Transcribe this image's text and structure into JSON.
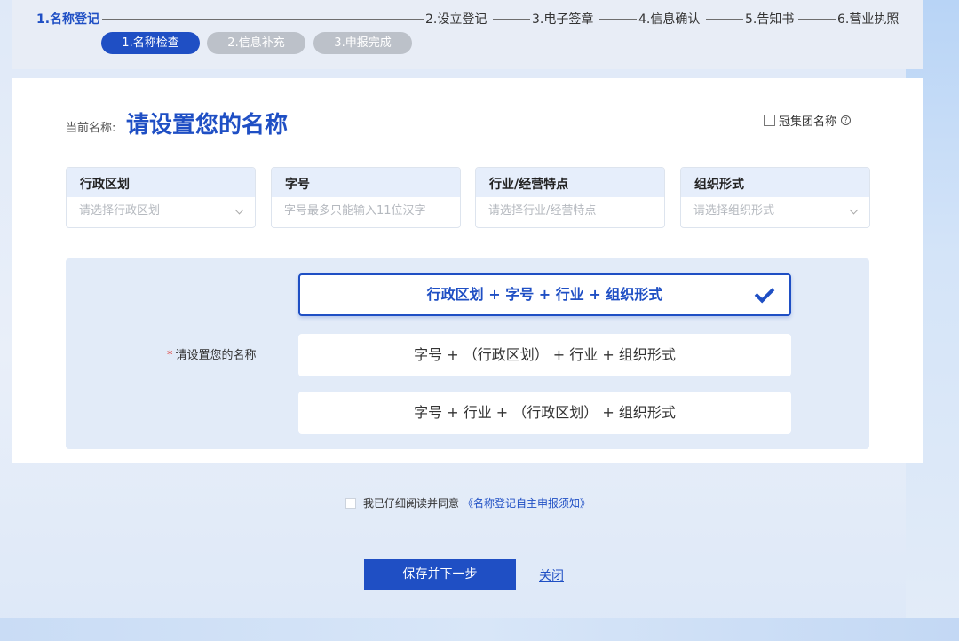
{
  "steps": {
    "items": [
      {
        "label": "1.名称登记",
        "active": true
      },
      {
        "label": "2.设立登记",
        "active": false
      },
      {
        "label": "3.电子签章",
        "active": false
      },
      {
        "label": "4.信息确认",
        "active": false
      },
      {
        "label": "5.告知书",
        "active": false
      },
      {
        "label": "6.营业执照",
        "active": false
      }
    ],
    "substeps": [
      {
        "label": "1.名称检查",
        "active": true
      },
      {
        "label": "2.信息补充",
        "active": false
      },
      {
        "label": "3.申报完成",
        "active": false
      }
    ]
  },
  "name_setting": {
    "current_label": "当前名称:",
    "current_value": "请设置您的名称",
    "group_checkbox_label": "冠集团名称",
    "help_glyph": "?",
    "fields": [
      {
        "label": "行政区划",
        "placeholder": "请选择行政区划",
        "has_dropdown": true
      },
      {
        "label": "字号",
        "placeholder": "字号最多只能输入11位汉字",
        "has_dropdown": false
      },
      {
        "label": "行业/经营特点",
        "placeholder": "请选择行业/经营特点",
        "has_dropdown": false
      },
      {
        "label": "组织形式",
        "placeholder": "请选择组织形式",
        "has_dropdown": true
      }
    ],
    "format_label": "请设置您的名称",
    "required_star": "*",
    "options": [
      {
        "label": "行政区划 + 字号 + 行业 + 组织形式",
        "selected": true
      },
      {
        "label": "字号 + （行政区划） + 行业 + 组织形式",
        "selected": false
      },
      {
        "label": "字号 + 行业 + （行政区划） + 组织形式",
        "selected": false
      }
    ]
  },
  "agreement": {
    "text": "我已仔细阅读并同意",
    "link": "《名称登记自主申报须知》"
  },
  "actions": {
    "save_label": "保存并下一步",
    "close_label": "关闭"
  },
  "colors": {
    "accent": "#1f4fc4",
    "inactive_pill": "#bcc1c9",
    "required": "#e0413d"
  }
}
